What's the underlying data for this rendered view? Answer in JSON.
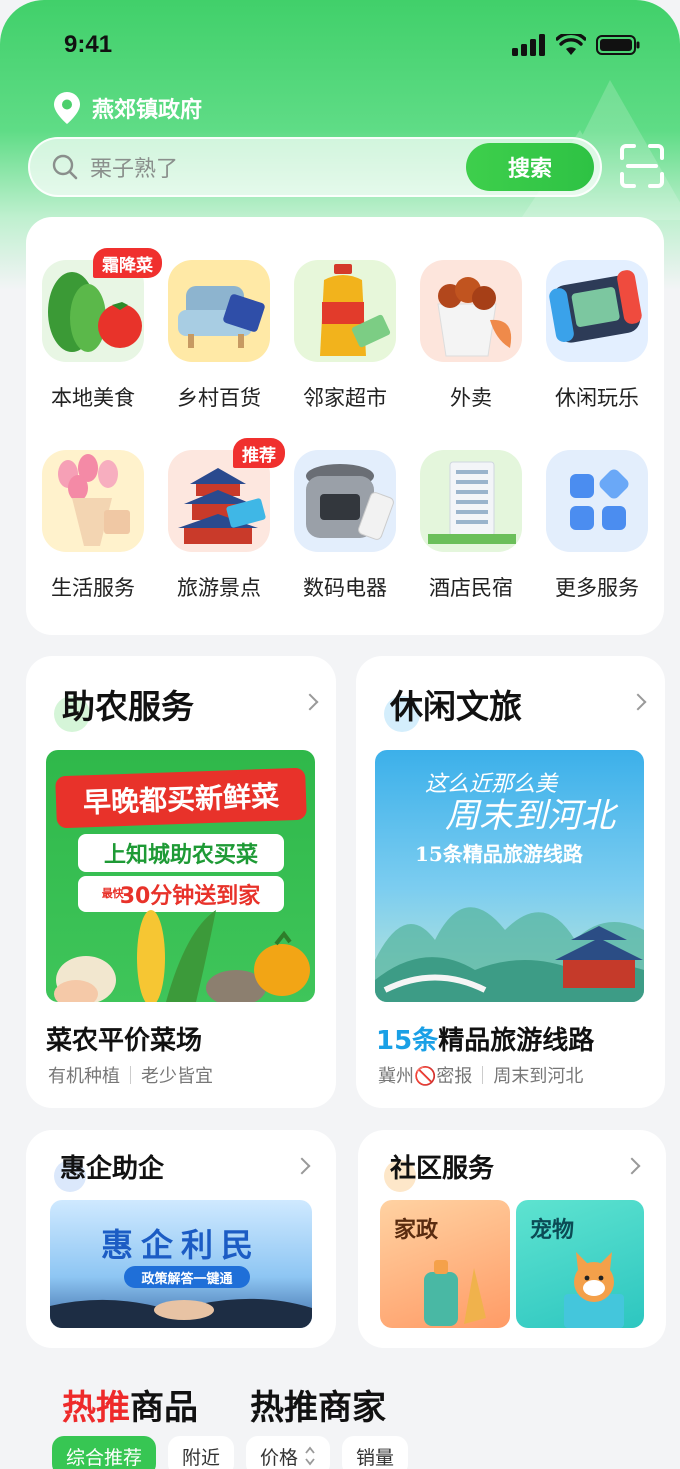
{
  "status_bar": {
    "time": "9:41"
  },
  "location": {
    "text": "燕郊镇政府"
  },
  "search": {
    "placeholder": "栗子熟了",
    "button_label": "搜索"
  },
  "categories": [
    {
      "label": "本地美食",
      "tag": "霜降菜",
      "icon": "vegetables-icon"
    },
    {
      "label": "乡村百货",
      "tag": "",
      "icon": "armchair-icon"
    },
    {
      "label": "邻家超市",
      "tag": "",
      "icon": "oil-bottle-icon"
    },
    {
      "label": "外卖",
      "tag": "",
      "icon": "fried-chicken-icon"
    },
    {
      "label": "休闲玩乐",
      "tag": "",
      "icon": "game-console-icon"
    },
    {
      "label": "生活服务",
      "tag": "",
      "icon": "flowers-icon"
    },
    {
      "label": "旅游景点",
      "tag": "推荐",
      "icon": "temple-icon"
    },
    {
      "label": "数码电器",
      "tag": "",
      "icon": "rice-cooker-icon"
    },
    {
      "label": "酒店民宿",
      "tag": "",
      "icon": "hotel-building-icon"
    },
    {
      "label": "更多服务",
      "tag": "",
      "icon": "grid-apps-icon"
    }
  ],
  "farm_panel": {
    "title": "助农服务",
    "banner": {
      "line1": "早晚都买新鲜菜",
      "line2": "上知城助农买菜",
      "line3_prefix": "最快",
      "line3": "30分钟送到家"
    },
    "subtitle": "菜农平价菜场",
    "meta": [
      "有机种植",
      "老少皆宜"
    ]
  },
  "travel_panel": {
    "title": "休闲文旅",
    "banner": {
      "line1": "这么近那么美",
      "line2": "周末到河北",
      "line3": "15条精品旅游线路"
    },
    "subtitle_highlight": "15条",
    "subtitle_rest": "精品旅游线路",
    "meta_prefix": "冀州",
    "meta_icon": "🚫",
    "meta_mid": "密报",
    "meta_after": "周末到河北"
  },
  "enterprise_panel": {
    "title": "惠企助企",
    "banner": {
      "line1": "惠企利民",
      "line2": "政策解答一键通"
    }
  },
  "community_panel": {
    "title": "社区服务",
    "tiles": [
      {
        "label": "家政"
      },
      {
        "label": "宠物"
      }
    ]
  },
  "bottom": {
    "tabs": [
      {
        "hot": "热推",
        "rest": "商品"
      },
      {
        "label": "热推商家"
      }
    ],
    "filters": [
      {
        "label": "综合推荐"
      },
      {
        "label": "附近"
      },
      {
        "label": "价格"
      },
      {
        "label": "销量"
      }
    ]
  },
  "colors": {
    "brand_green": "#37c653",
    "hot_red": "#ee2a2a",
    "tag_red": "#f0302e",
    "accent_blue": "#1aa0e6"
  }
}
